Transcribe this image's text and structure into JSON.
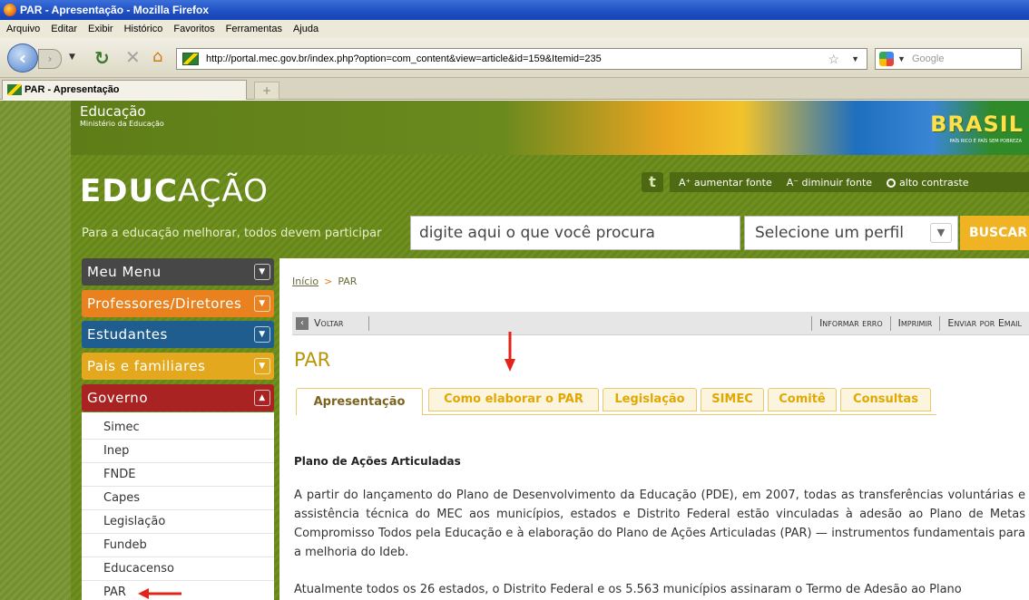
{
  "window": {
    "title": "PAR - Apresentação - Mozilla Firefox"
  },
  "menu": [
    "Arquivo",
    "Editar",
    "Exibir",
    "Histórico",
    "Favoritos",
    "Ferramentas",
    "Ajuda"
  ],
  "toolbar": {
    "url": "http://portal.mec.gov.br/index.php?option=com_content&view=article&id=159&Itemid=235",
    "search_placeholder": "Google"
  },
  "tab": {
    "label": "PAR - Apresentação"
  },
  "header": {
    "ministry_small": "Educação",
    "ministry_sub": "Ministério da Educação",
    "brasil": "BRASIL",
    "brasil_slogan": "PAÍS RICO É PAÍS SEM POBREZA",
    "logo_bold": "EDUC",
    "logo_rest": "AÇÃO",
    "tagline": "Para a educação melhorar, todos devem participar",
    "twitter": "t",
    "font_increase": "A⁺ aumentar fonte",
    "font_decrease": "A⁻ diminuir fonte",
    "contrast": "alto contraste",
    "search_placeholder": "digite aqui o que você procura",
    "profile_select": "Selecione um perfil",
    "search_button": "BUSCAR"
  },
  "sidebar": {
    "menus": [
      {
        "label": "Meu Menu",
        "color": "#474747"
      },
      {
        "label": "Professores/Diretores",
        "color": "#e8811e"
      },
      {
        "label": "Estudantes",
        "color": "#1f5d8e"
      },
      {
        "label": "Pais e familiares",
        "color": "#e3a81d"
      },
      {
        "label": "Governo",
        "color": "#a82321"
      }
    ],
    "subitems": [
      "Simec",
      "Inep",
      "FNDE",
      "Capes",
      "Legislação",
      "Fundeb",
      "Educacenso",
      "PAR"
    ]
  },
  "breadcrumb": {
    "home": "Início",
    "sep": ">",
    "current": "PAR"
  },
  "actions": {
    "back": "Voltar",
    "report": "Informar erro",
    "print": "Imprimir",
    "email": "Enviar por Email"
  },
  "page": {
    "title": "PAR",
    "tabs": [
      "Apresentação",
      "Como elaborar o PAR",
      "Legislação",
      "SIMEC",
      "Comitê",
      "Consultas"
    ],
    "heading": "Plano de Ações Articuladas",
    "paragraph1": "A partir do lançamento do Plano de Desenvolvimento da Educação (PDE), em 2007, todas as transferências voluntárias e assistência técnica do MEC aos municípios, estados e Distrito Federal estão vinculadas à adesão ao Plano de Metas Compromisso Todos pela Educação e à elaboração do Plano de Ações Articuladas (PAR) — instrumentos fundamentais para a melhoria do Ideb.",
    "paragraph2": "Atualmente todos os 26 estados, o Distrito Federal e os 5.563 municípios assinaram o Termo de Adesão ao Plano"
  }
}
